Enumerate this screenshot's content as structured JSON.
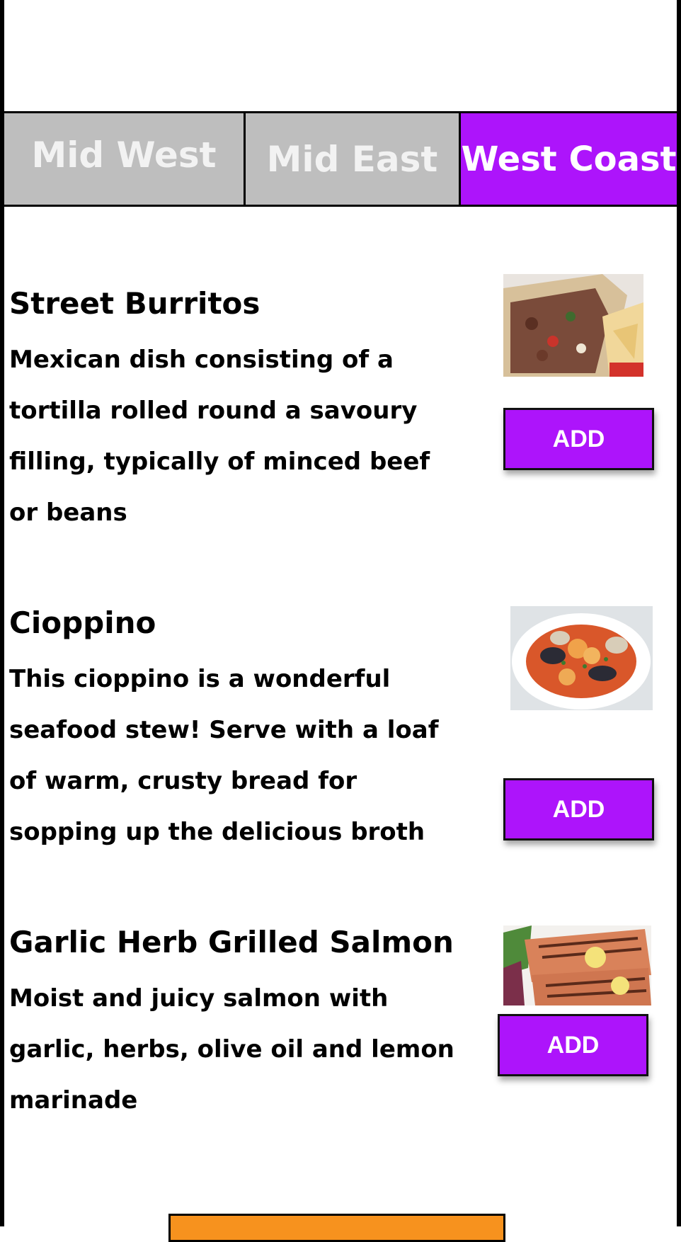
{
  "tabs": [
    {
      "label": "Mid West"
    },
    {
      "label": "Mid East"
    },
    {
      "label": "West Coast"
    }
  ],
  "active_tab": "West Coast",
  "accent_color": "#ad14fb",
  "items": [
    {
      "title": "Street Burritos",
      "description": "Mexican dish consisting of a tortilla rolled round a savoury filling, typically of minced beef or beans",
      "button": "ADD",
      "image_icon": "burrito-image"
    },
    {
      "title": "Cioppino",
      "description": "This cioppino is a wonderful seafood stew! Serve with a loaf of warm, crusty bread for sopping up the delicious broth",
      "button": "ADD",
      "image_icon": "seafood-stew-image"
    },
    {
      "title": "Garlic Herb Grilled Salmon",
      "description": "Moist and juicy salmon with garlic, herbs, olive oil and lemon marinade",
      "button": "ADD",
      "image_icon": "grilled-salmon-image"
    }
  ]
}
